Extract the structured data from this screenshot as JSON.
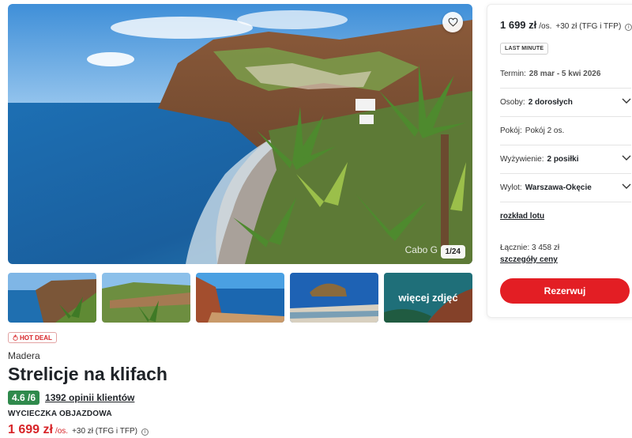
{
  "gallery": {
    "caption": "Cabo G",
    "counter": "1/24",
    "more_photos_label": "więcej zdjęć"
  },
  "offer": {
    "badge": "HOT DEAL",
    "region": "Madera",
    "title": "Strelicje na klifach",
    "rating": "4.6 /6",
    "reviews": "1392 opinii klientów",
    "trip_type": "WYCIECZKA OBJAZDOWA",
    "price": "1 699 zł",
    "per_person": "/os.",
    "extra_fee": "+30 zł (TFG i TFP)"
  },
  "booking": {
    "price": "1 699 zł",
    "per_person": "/os.",
    "extra_fee": "+30 zł (TFG i TFP)",
    "badge": "LAST MINUTE",
    "term": {
      "label": "Termin:",
      "value": "28 mar - 5 kwi 2026"
    },
    "persons": {
      "label": "Osoby:",
      "value": "2 dorosłych"
    },
    "room": {
      "label": "Pokój:",
      "value": "Pokój 2 os."
    },
    "board": {
      "label": "Wyżywienie:",
      "value": "2 posiłki"
    },
    "departure": {
      "label": "Wylot:",
      "value": "Warszawa-Okęcie"
    },
    "flight_schedule": "rozkład lotu",
    "total": "Łącznie: 3 458 zł",
    "price_details": "szczegóły ceny",
    "book_button": "Rezerwuj"
  },
  "icons": {
    "favorite": "heart-icon",
    "info": "info-icon",
    "chevron": "chevron-down-icon",
    "hot": "flame-icon"
  },
  "colors": {
    "accent": "#e31e24",
    "price": "#d72428",
    "rating": "#2f8a4c"
  }
}
